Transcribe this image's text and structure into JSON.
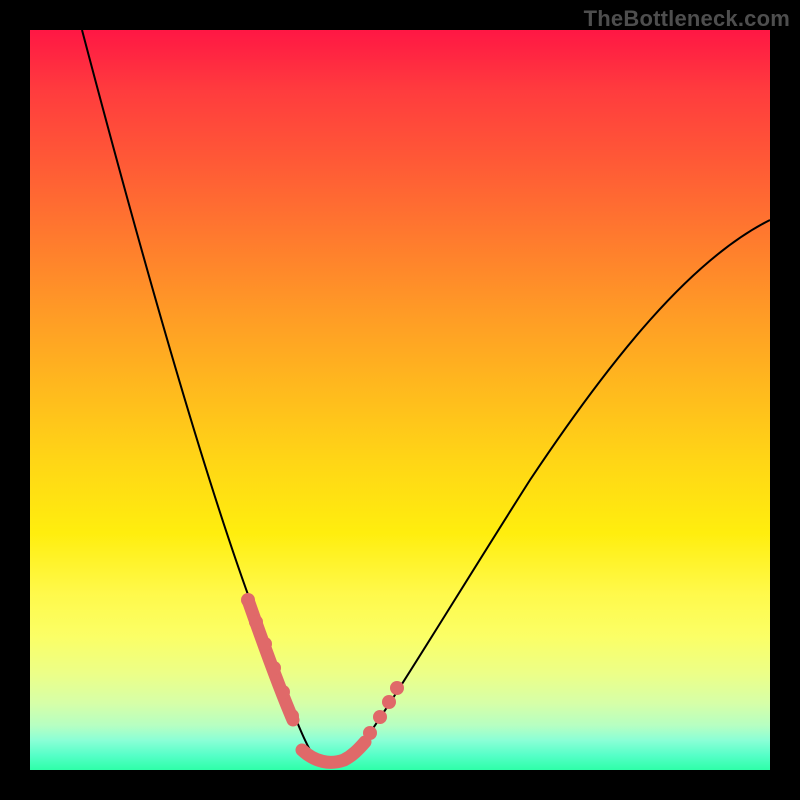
{
  "watermark": "TheBottleneck.com",
  "colors": {
    "background": "#000000",
    "curve": "#000000",
    "marker": "#e06969",
    "gradient_top": "#ff1744",
    "gradient_bottom": "#2effa8"
  },
  "chart_data": {
    "type": "line",
    "title": "",
    "xlabel": "",
    "ylabel": "",
    "xlim": [
      0,
      100
    ],
    "ylim": [
      0,
      100
    ],
    "x": [
      7,
      10,
      13,
      16,
      19,
      22,
      25,
      28,
      30,
      32,
      34,
      35,
      36,
      37,
      38,
      40,
      42,
      45,
      50,
      55,
      60,
      65,
      70,
      75,
      80,
      85,
      90,
      95,
      100
    ],
    "y": [
      100,
      88,
      77,
      67,
      58,
      49,
      41,
      33,
      26,
      20,
      14,
      10,
      6,
      3,
      2,
      2,
      3,
      6,
      13,
      21,
      29,
      36,
      43,
      49,
      55,
      60,
      65,
      70,
      74
    ],
    "annotations": [],
    "highlight_region_x": [
      29,
      47
    ],
    "notes": "V-shaped bottleneck curve; minimum near x≈38. Highlighted salmon dots/segments mark the near-optimal region around the trough. No axis tick labels are rendered in the image; values are estimated from shape."
  }
}
